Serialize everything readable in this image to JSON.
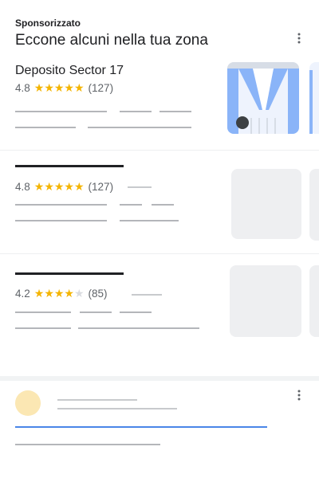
{
  "header": {
    "sponsored_label": "Sponsorizzato",
    "title": "Eccone alcuni nella tua zona",
    "menu_icon": "more-vert-icon"
  },
  "listings": [
    {
      "name": "Deposito Sector 17",
      "rating": "4.8",
      "stars": 5,
      "reviews": "(127)",
      "image": "warehouse-photo"
    },
    {
      "name": "",
      "rating": "4.8",
      "stars": 5,
      "reviews": "(127)",
      "image": "placeholder"
    },
    {
      "name": "",
      "rating": "4.2",
      "stars": 4,
      "reviews": "(85)",
      "image": "placeholder"
    }
  ],
  "bottom_card": {
    "menu_icon": "more-vert-icon",
    "avatar_color": "#fbe7b3"
  },
  "colors": {
    "star": "#f4b400",
    "accent": "#4a86e8",
    "photo_blue": "#8ab4f8"
  }
}
